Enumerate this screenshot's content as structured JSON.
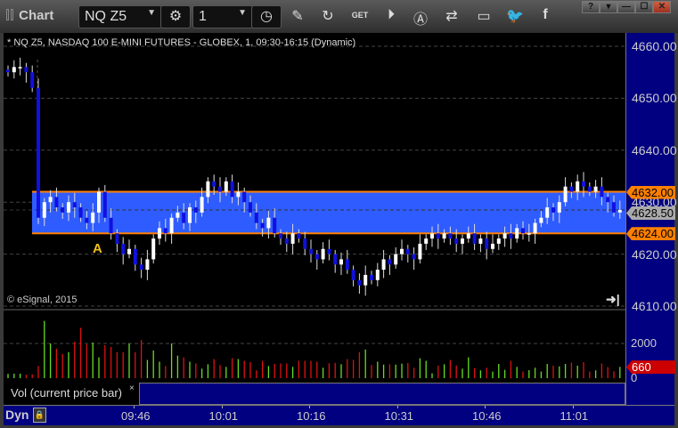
{
  "window": {
    "title": "Chart",
    "symbol": "NQ Z5",
    "interval": "1",
    "win_buttons": [
      "?",
      "▾",
      "—",
      "☐",
      "✕"
    ]
  },
  "toolbar_icons": [
    "settings-icon",
    "clock-icon",
    "pencil-icon",
    "refresh-icon",
    "get-icon",
    "play-icon",
    "a-alert-icon",
    "link-icon",
    "chat-icon",
    "twitter-icon",
    "facebook-icon"
  ],
  "chart": {
    "header": "* NQ Z5, NASDAQ 100 E-MINI FUTURES - GLOBEX, 1, 09:30-16:15 (Dynamic)",
    "copyright": "© eSignal, 2015",
    "price_ticks": [
      "4660.00",
      "4650.00",
      "4640.00",
      "4630.00",
      "4620.00",
      "4610.00"
    ],
    "price_tick_values": [
      4660,
      4650,
      4640,
      4630,
      4620,
      4610
    ],
    "band": {
      "upper": 4632,
      "lower": 4624,
      "upper_label": "4632.00",
      "lower_label": "4624.00",
      "label": "A"
    },
    "last_price": 4628.5,
    "last_price_label": "4628.50",
    "closes": [
      4655,
      4656,
      4656,
      4655,
      4652,
      4627,
      4630,
      4631,
      4629,
      4628,
      4630,
      4629,
      4627,
      4626,
      4628,
      4632,
      4627,
      4624,
      4622,
      4620,
      4621,
      4618,
      4617,
      4619,
      4623,
      4625,
      4624,
      4627,
      4628,
      4626,
      4629,
      4628,
      4631,
      4634,
      4633,
      4632,
      4634,
      4631,
      4632,
      4630,
      4628,
      4626,
      4625,
      4627,
      4624,
      4623,
      4622,
      4624,
      4623,
      4621,
      4620,
      4619,
      4621,
      4620,
      4618,
      4619,
      4617,
      4615,
      4614,
      4616,
      4615,
      4617,
      4619,
      4618,
      4620,
      4621,
      4620,
      4619,
      4622,
      4623,
      4624,
      4623,
      4624,
      4623,
      4622,
      4623,
      4624,
      4622,
      4623,
      4621,
      4622,
      4623,
      4624,
      4623,
      4625,
      4624,
      4624,
      4626,
      4627,
      4629,
      4628,
      4630,
      4633,
      4632,
      4634,
      4633,
      4632,
      4633,
      4631,
      4630,
      4628,
      4628.5
    ],
    "colors": {
      "band": "#2f5cff",
      "band_line": "#ff8000",
      "up": "#ffffff",
      "down": "#1010e0",
      "vol_up": "#66dd22",
      "vol_down": "#dd1111"
    }
  },
  "volume": {
    "label": "Vol (current price bar)",
    "close": "×",
    "ticks": [
      "2000",
      "0"
    ],
    "tick_values": [
      2000,
      0
    ],
    "current_label": "660",
    "values": [
      250,
      260,
      260,
      200,
      220,
      700,
      3300,
      2000,
      1700,
      1400,
      1500,
      2100,
      2900,
      1950,
      2050,
      1200,
      1900,
      1800,
      1500,
      1500,
      2000,
      1500,
      2200,
      1050,
      1600,
      950,
      700,
      2000,
      1300,
      1200,
      950,
      850,
      550,
      800,
      1100,
      750,
      650,
      1150,
      1100,
      1000,
      920,
      450,
      1000,
      700,
      820,
      850,
      850,
      650,
      1000,
      1000,
      1000,
      950,
      600,
      860,
      880,
      800,
      1100,
      1050,
      1500,
      1650,
      760,
      950,
      780,
      800,
      780,
      840,
      880,
      600,
      1150,
      1000,
      280,
      720,
      800,
      1050,
      730,
      550,
      1200,
      580,
      450,
      600,
      380,
      820,
      480,
      1000,
      650,
      380,
      460,
      600,
      380,
      820,
      720,
      680,
      820,
      900,
      720,
      920,
      380,
      450,
      840,
      640,
      400,
      650,
      1300,
      620,
      1500,
      1040,
      1200,
      640,
      660
    ],
    "ymax": 3500
  },
  "time_axis": {
    "labels": [
      "09:46",
      "10:01",
      "10:16",
      "10:31",
      "10:46",
      "11:01"
    ],
    "dyn": "Dyn"
  }
}
